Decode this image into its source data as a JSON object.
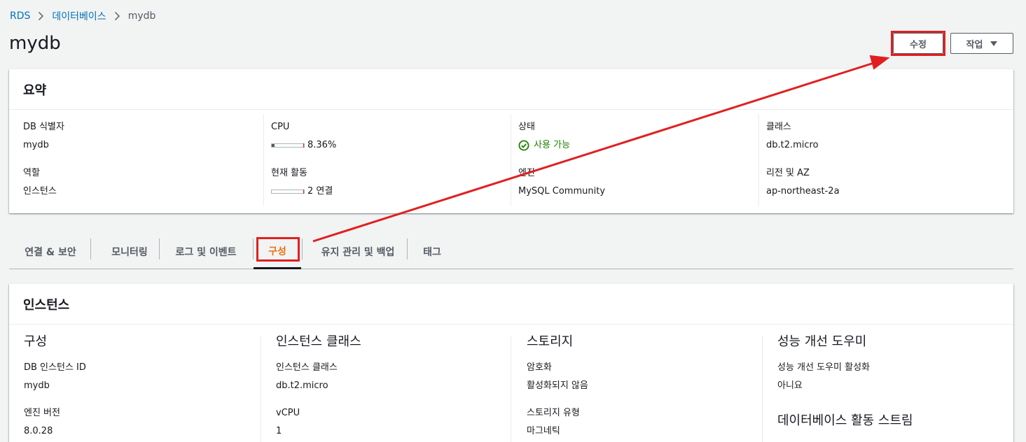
{
  "breadcrumb": {
    "items": [
      "RDS",
      "데이터베이스"
    ],
    "current": "mydb"
  },
  "page": {
    "title": "mydb"
  },
  "header_buttons": {
    "modify": "수정",
    "actions": "작업"
  },
  "summary": {
    "title": "요약",
    "db_identifier": {
      "label": "DB 식별자",
      "value": "mydb"
    },
    "role": {
      "label": "역할",
      "value": "인스턴스"
    },
    "cpu": {
      "label": "CPU",
      "value": "8.36%",
      "percent": 8.36
    },
    "activity": {
      "label": "현재 활동",
      "value": "2 연결"
    },
    "status": {
      "label": "상태",
      "value": "사용 가능"
    },
    "engine": {
      "label": "엔진",
      "value": "MySQL Community"
    },
    "class": {
      "label": "클래스",
      "value": "db.t2.micro"
    },
    "region": {
      "label": "리전 및 AZ",
      "value": "ap-northeast-2a"
    }
  },
  "tabs": [
    {
      "label": "연결 & 보안"
    },
    {
      "label": "모니터링"
    },
    {
      "label": "로그 및 이벤트"
    },
    {
      "label": "구성",
      "active": true
    },
    {
      "label": "유지 관리 및 백업"
    },
    {
      "label": "태그"
    }
  ],
  "instance": {
    "title": "인스턴스",
    "configuration": {
      "title": "구성",
      "db_instance_id": {
        "label": "DB 인스턴스 ID",
        "value": "mydb"
      },
      "engine_version": {
        "label": "엔진 버전",
        "value": "8.0.28"
      }
    },
    "instance_class": {
      "title": "인스턴스 클래스",
      "class": {
        "label": "인스턴스 클래스",
        "value": "db.t2.micro"
      },
      "vcpu": {
        "label": "vCPU",
        "value": "1"
      }
    },
    "storage": {
      "title": "스토리지",
      "encryption": {
        "label": "암호화",
        "value": "활성화되지 않음"
      },
      "storage_type": {
        "label": "스토리지 유형",
        "value": "마그네틱"
      }
    },
    "performance": {
      "title": "성능 개선 도우미",
      "enabled": {
        "label": "성능 개선 도우미 활성화",
        "value": "아니요"
      },
      "activity_stream_title": "데이터베이스 활동 스트림"
    }
  },
  "colors": {
    "link": "#0073bb",
    "active_tab": "#ec7211",
    "success": "#1d8102",
    "annotation": "#e02020"
  }
}
